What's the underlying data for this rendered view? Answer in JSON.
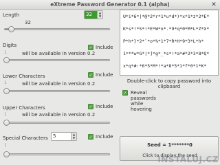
{
  "window": {
    "title": "eXtreme Password Generator 0.1 (alpha)",
    "close_symbol": "✕"
  },
  "length": {
    "label": "Length",
    "value": "32",
    "slider_value": "32",
    "slider_fraction": 0.32
  },
  "digits": {
    "label": "Digits",
    "min": "1",
    "note": "will be available in version 0.2",
    "include_label": "Include",
    "include_checked": true
  },
  "lower": {
    "label": "Lower Characters",
    "min": "1",
    "note": "will be available in version 0.2",
    "include_label": "Include",
    "include_checked": true
  },
  "upper": {
    "label": "Upper Characters",
    "min": "1",
    "note": "will be available in version 0.2",
    "include_label": "Include",
    "include_checked": true
  },
  "special": {
    "label": "Special Characters",
    "value": "5",
    "min": "1",
    "include_label": "Include",
    "include_checked": true
  },
  "password": {
    "lines": [
      "U*i*6*|*@*2*r*1*u*d*)*x*1*z*2*E*",
      "K*s*!*S*!*E*W*n*.*9*q*0*M*L*Z*X*",
      "P*h*}*2*`*o*%*1*7*R*H*9*3*L*h*",
      "1***w*G*|*]*g*_*s*!*a*#*2*3*8*Q*",
      "x*q*#:*6*5*M*!*a*8*5*1*f*0*1*K*"
    ],
    "copy_hint": "Double-click to copy password into clipboard"
  },
  "reveal": {
    "label": "Reveal passwords while hovering",
    "checked": true
  },
  "seed": {
    "label": "Seed = 1*******0",
    "hint": "Click to display the seed"
  },
  "watermark": {
    "text": "INSTALUJ.CZ"
  },
  "accent_color": "#3a9b2e"
}
